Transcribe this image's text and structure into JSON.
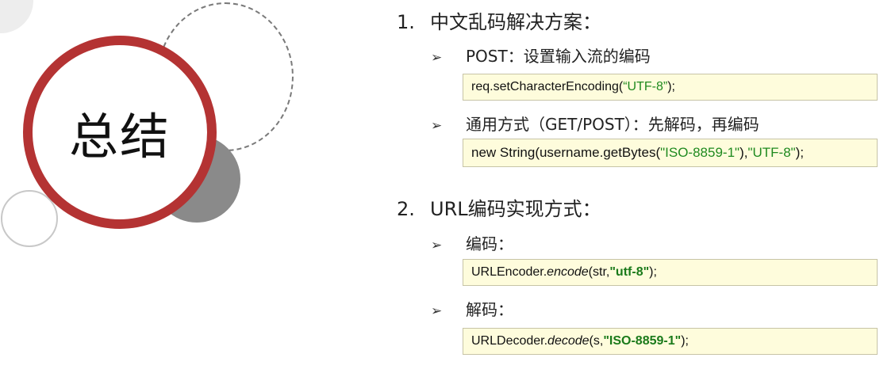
{
  "title": "总结",
  "sections": [
    {
      "number": "1.",
      "heading": "中文乱码解决方案：",
      "bullets": [
        {
          "arrow": "➢",
          "label": "POST：设置输入流的编码",
          "code": {
            "pre": "req.setCharacterEncoding(",
            "str": "“UTF-8”",
            "post": ");"
          }
        },
        {
          "arrow": "➢",
          "label": "通用方式（GET/POST）：先解码，再编码",
          "code": {
            "pre": "new String(username.getBytes(",
            "str1": "\"ISO-8859-1\"",
            "mid": "),",
            "str2": "\"UTF-8\"",
            "post": ");"
          }
        }
      ]
    },
    {
      "number": "2.",
      "heading": "URL编码实现方式：",
      "bullets": [
        {
          "arrow": "➢",
          "label": "编码：",
          "code": {
            "pre": "URLEncoder.",
            "method": "encode",
            "args": "(str, ",
            "str": "\"utf-8\"",
            "post": ");"
          }
        },
        {
          "arrow": "➢",
          "label": "解码：",
          "code": {
            "pre": "URLDecoder.",
            "method": "decode",
            "args": "(s, ",
            "str": "\"ISO-8859-1\"",
            "post": ");"
          }
        }
      ]
    }
  ],
  "colors": {
    "ring": "#b43333",
    "code_bg": "#fefcdc",
    "string": "#1f8a1f"
  }
}
